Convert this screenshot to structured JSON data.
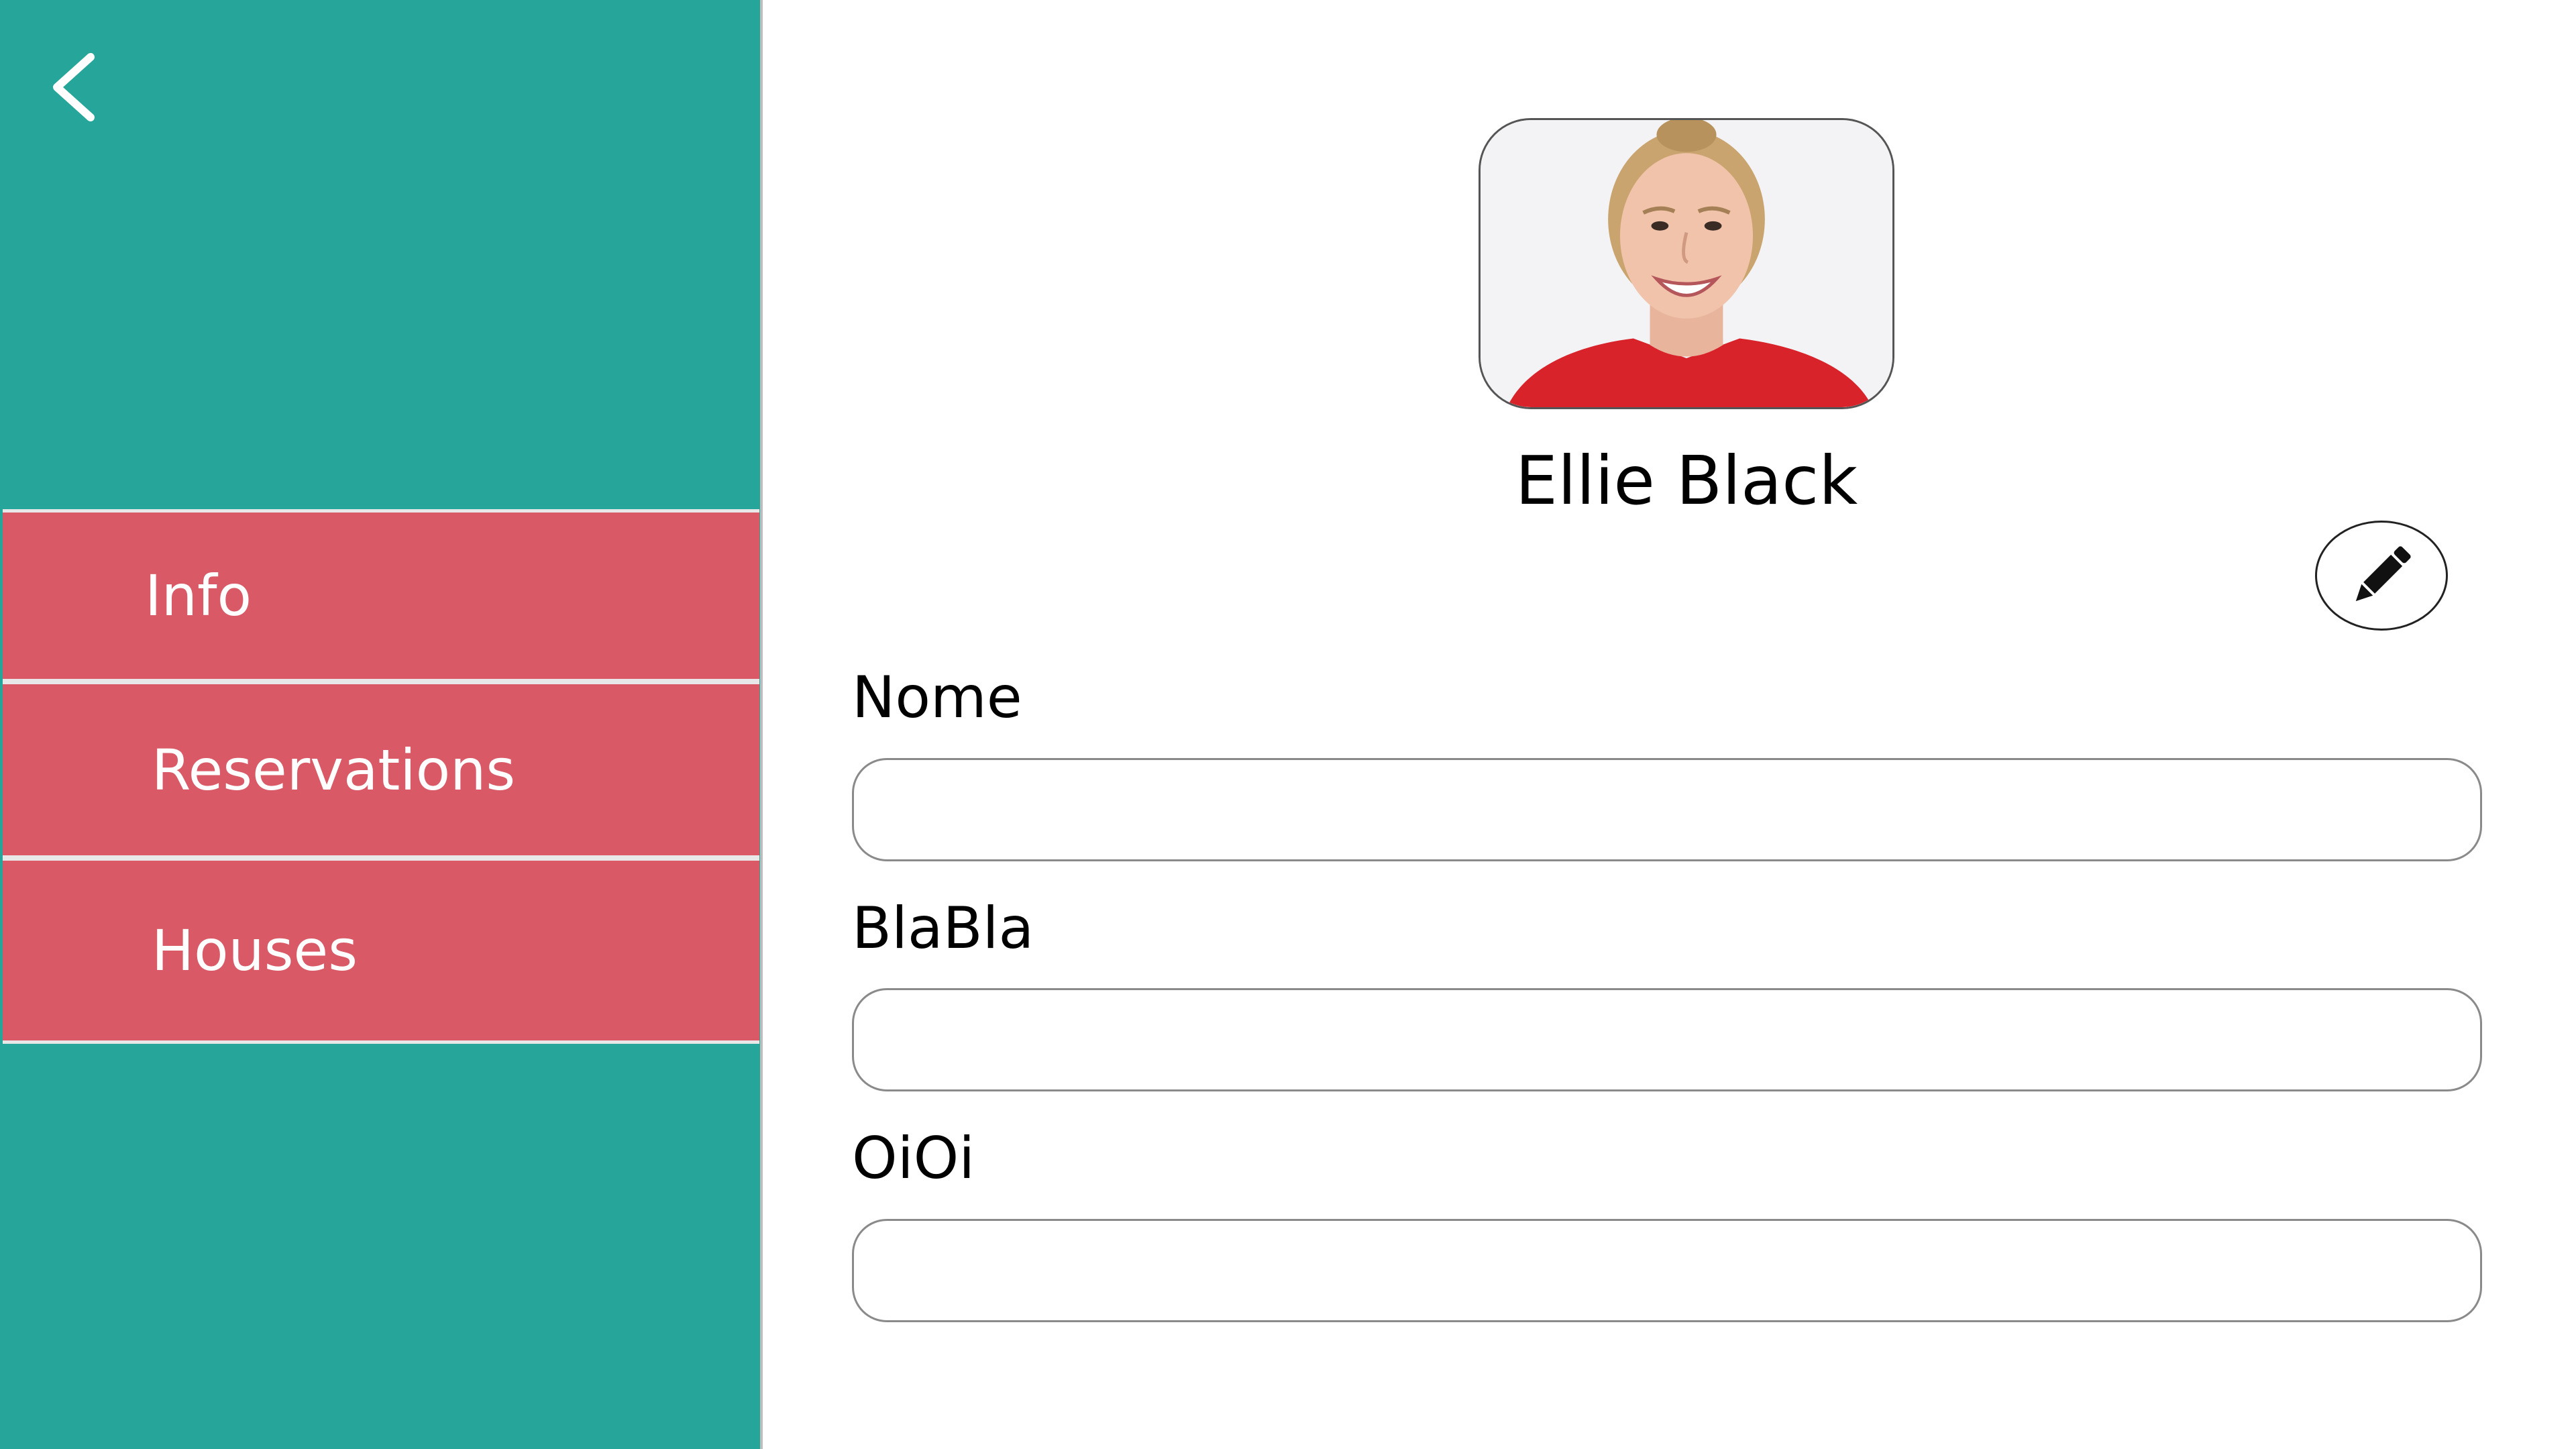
{
  "sidebar": {
    "back_icon": "chevron-left-icon",
    "items": [
      {
        "label": "Info"
      },
      {
        "label": "Reservations"
      },
      {
        "label": "Houses"
      }
    ]
  },
  "profile": {
    "name": "Ellie Black",
    "avatar": "profile-photo",
    "edit_icon": "pencil-icon"
  },
  "form": {
    "fields": [
      {
        "label": "Nome",
        "value": "",
        "placeholder": ""
      },
      {
        "label": "BlaBla",
        "value": "",
        "placeholder": ""
      },
      {
        "label": "OiOi",
        "value": "",
        "placeholder": ""
      }
    ]
  },
  "colors": {
    "sidebar": "#26a69a",
    "nav_item": "#d95a66",
    "text": "#000000",
    "nav_text": "#ffffff"
  }
}
